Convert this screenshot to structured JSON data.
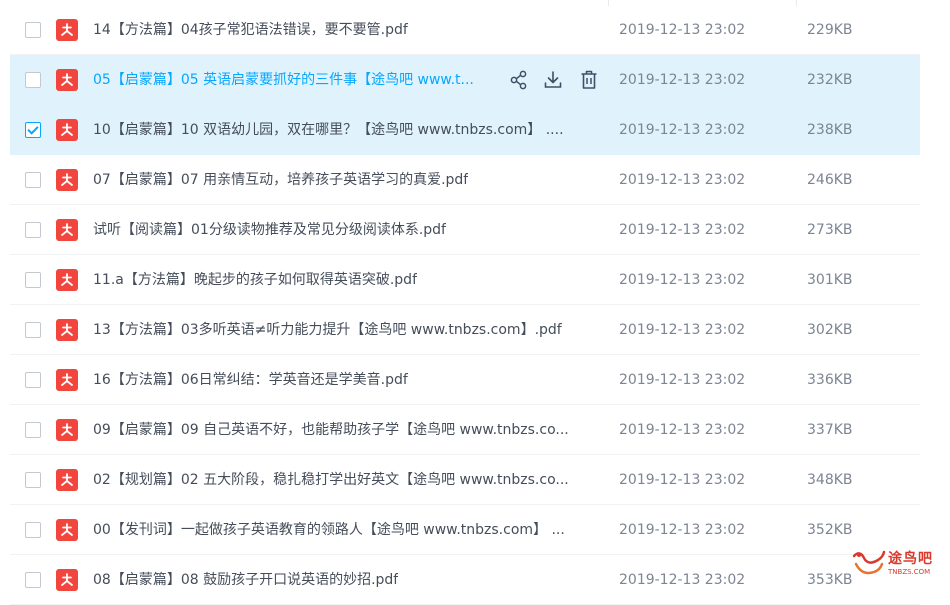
{
  "files": [
    {
      "name": "14【方法篇】04孩子常犯语法错误，要不要管.pdf",
      "date": "2019-12-13 23:02",
      "size": "229KB",
      "checked": false,
      "state": ""
    },
    {
      "name": "05【启蒙篇】05 英语启蒙要抓好的三件事【途鸟吧 www.t...",
      "date": "2019-12-13 23:02",
      "size": "232KB",
      "checked": false,
      "state": "hover"
    },
    {
      "name": "10【启蒙篇】10 双语幼儿园，双在哪里？【途鸟吧 www.tnbzs.com】 ....",
      "date": "2019-12-13 23:02",
      "size": "238KB",
      "checked": true,
      "state": "selected"
    },
    {
      "name": "07【启蒙篇】07 用亲情互动，培养孩子英语学习的真爱.pdf",
      "date": "2019-12-13 23:02",
      "size": "246KB",
      "checked": false,
      "state": ""
    },
    {
      "name": "试听【阅读篇】01分级读物推荐及常见分级阅读体系.pdf",
      "date": "2019-12-13 23:02",
      "size": "273KB",
      "checked": false,
      "state": ""
    },
    {
      "name": "11.a【方法篇】晚起步的孩子如何取得英语突破.pdf",
      "date": "2019-12-13 23:02",
      "size": "301KB",
      "checked": false,
      "state": ""
    },
    {
      "name": "13【方法篇】03多听英语≠听力能力提升【途鸟吧 www.tnbzs.com】.pdf",
      "date": "2019-12-13 23:02",
      "size": "302KB",
      "checked": false,
      "state": ""
    },
    {
      "name": "16【方法篇】06日常纠结：学英音还是学美音.pdf",
      "date": "2019-12-13 23:02",
      "size": "336KB",
      "checked": false,
      "state": ""
    },
    {
      "name": "09【启蒙篇】09 自己英语不好，也能帮助孩子学【途鸟吧 www.tnbzs.co...",
      "date": "2019-12-13 23:02",
      "size": "337KB",
      "checked": false,
      "state": ""
    },
    {
      "name": "02【规划篇】02 五大阶段，稳扎稳打学出好英文【途鸟吧 www.tnbzs.co...",
      "date": "2019-12-13 23:02",
      "size": "348KB",
      "checked": false,
      "state": ""
    },
    {
      "name": "00【发刊词】一起做孩子英语教育的领路人【途鸟吧 www.tnbzs.com】 ...",
      "date": "2019-12-13 23:02",
      "size": "352KB",
      "checked": false,
      "state": ""
    },
    {
      "name": "08【启蒙篇】08 鼓励孩子开口说英语的妙招.pdf",
      "date": "2019-12-13 23:02",
      "size": "353KB",
      "checked": false,
      "state": ""
    }
  ],
  "row_actions": [
    "share-icon",
    "download-icon",
    "delete-icon"
  ],
  "colors": {
    "accent": "#06a7ff",
    "row_highlight": "#e0f3fd",
    "pdf_icon": "#f2453d",
    "watermark": "#d93a2b"
  },
  "watermark": {
    "logo_icon": "tunbaba-bird-logo",
    "text": "途鸟吧",
    "subtext": "TNBZS.COM"
  }
}
